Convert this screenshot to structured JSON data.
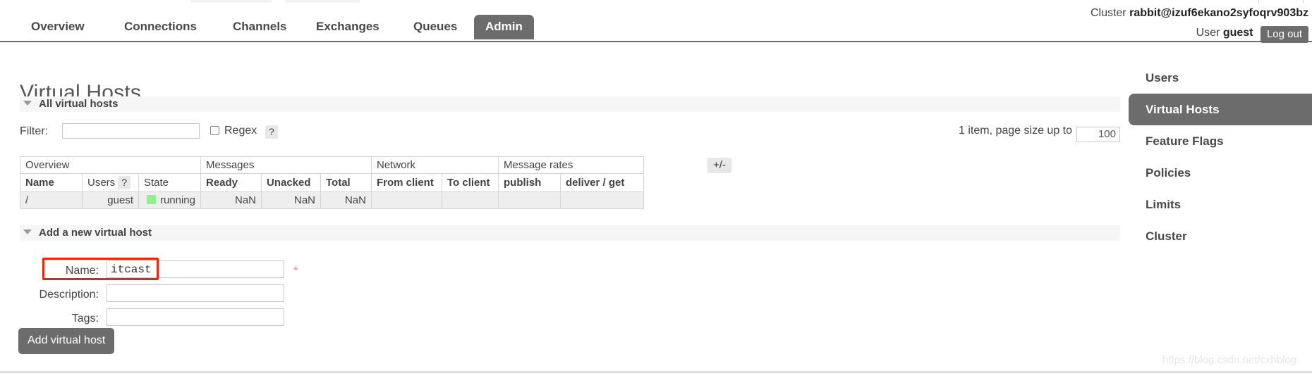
{
  "header": {
    "cluster_label": "Cluster",
    "cluster_name": "rabbit@izuf6ekano2syfoqrv903bz",
    "user_label": "User",
    "user_name": "guest",
    "logout_label": "Log out"
  },
  "nav": {
    "tabs": [
      {
        "label": "Overview",
        "selected": false
      },
      {
        "label": "Connections",
        "selected": false
      },
      {
        "label": "Channels",
        "selected": false
      },
      {
        "label": "Exchanges",
        "selected": false
      },
      {
        "label": "Queues",
        "selected": false
      },
      {
        "label": "Admin",
        "selected": true
      }
    ]
  },
  "page": {
    "title": "Virtual Hosts"
  },
  "all_vhosts_section": {
    "header": "All virtual hosts",
    "filter_label": "Filter:",
    "filter_value": "",
    "filter_placeholder": "",
    "regex_label": "Regex",
    "regex_checked": false,
    "regex_help": "?",
    "paging_text": "1 item, page size up to",
    "page_size": "100",
    "plus_minus": "+/-"
  },
  "table": {
    "group_headers": [
      {
        "label": "Overview",
        "span": 3
      },
      {
        "label": "Messages",
        "span": 3
      },
      {
        "label": "Network",
        "span": 2
      },
      {
        "label": "Message rates",
        "span": 2
      }
    ],
    "columns": [
      "Name",
      "Users",
      "State",
      "Ready",
      "Unacked",
      "Total",
      "From client",
      "To client",
      "publish",
      "deliver / get"
    ],
    "users_help": "?",
    "rows": [
      {
        "name": "/",
        "users": "guest",
        "state": "running",
        "state_color": "#91ef91",
        "ready": "NaN",
        "unacked": "NaN",
        "total": "NaN",
        "from_client": "",
        "to_client": "",
        "publish": "",
        "deliver_get": ""
      }
    ]
  },
  "add_form": {
    "header": "Add a new virtual host",
    "fields": [
      {
        "label": "Name:",
        "value": "itcast",
        "required": true
      },
      {
        "label": "Description:",
        "value": "",
        "required": false
      },
      {
        "label": "Tags:",
        "value": "",
        "required": false
      }
    ],
    "required_marker": "*",
    "submit_label": "Add virtual host",
    "highlight_color": "#f22100"
  },
  "sidebar": {
    "items": [
      {
        "label": "Users",
        "selected": false
      },
      {
        "label": "Virtual Hosts",
        "selected": true
      },
      {
        "label": "Feature Flags",
        "selected": false
      },
      {
        "label": "Policies",
        "selected": false
      },
      {
        "label": "Limits",
        "selected": false
      },
      {
        "label": "Cluster",
        "selected": false
      }
    ]
  },
  "watermark": {
    "text": "https://blog.csdn.net/cxhblog"
  }
}
